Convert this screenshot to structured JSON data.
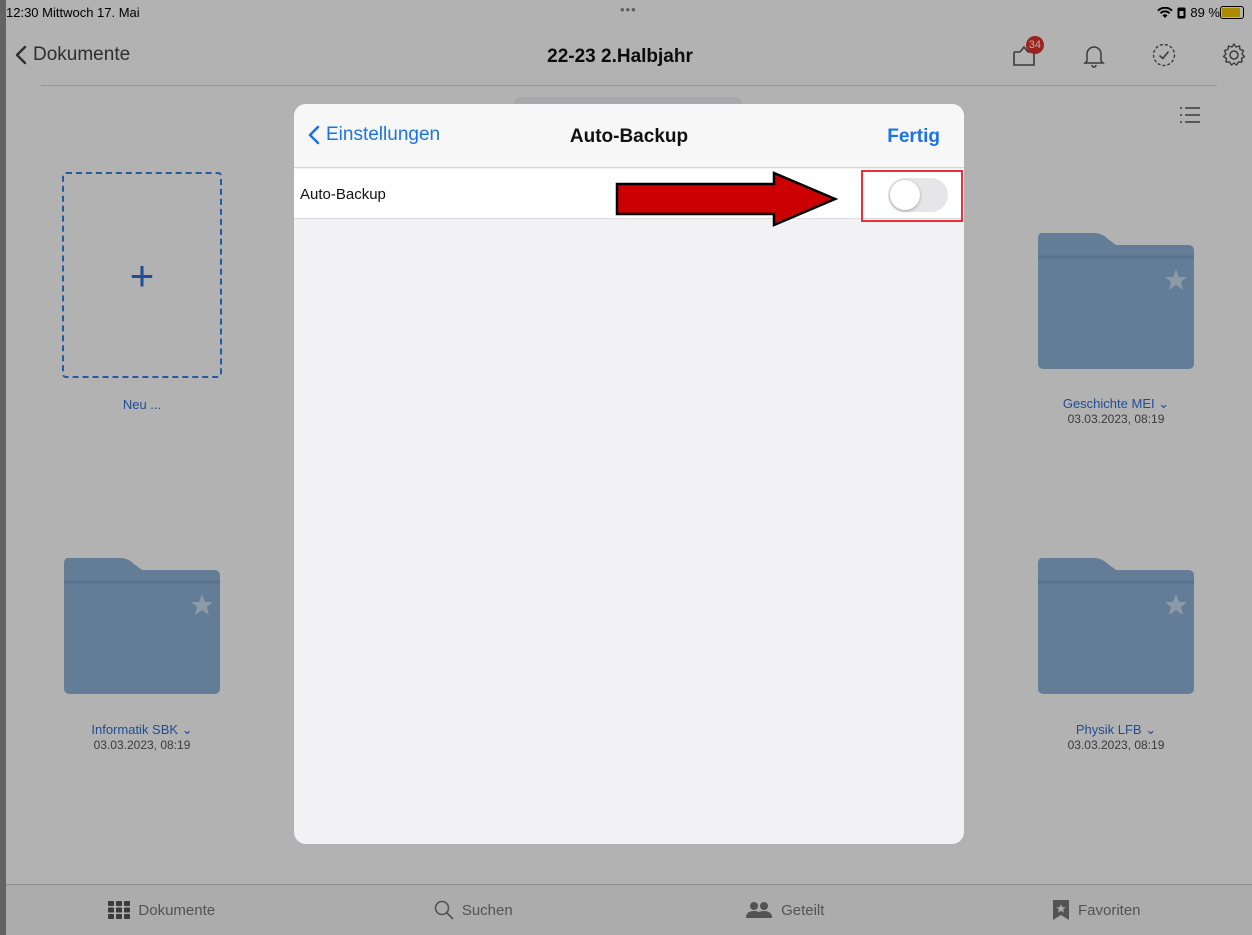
{
  "status": {
    "time_date": "12:30  Mittwoch 17. Mai",
    "dots": "•••",
    "battery": "89 %",
    "battery_level": 0.89
  },
  "nav": {
    "back_label": "Dokumente",
    "title": "22-23 2.Halbjahr",
    "badge_count": "34"
  },
  "tiles": {
    "new_label": "Neu ...",
    "folders": [
      {
        "name": "Geschichte MEI",
        "date": "03.03.2023, 08:19"
      },
      {
        "name": "Informatik SBK",
        "date": "03.03.2023, 08:19"
      },
      {
        "name": "Physik LFB",
        "date": "03.03.2023, 08:19"
      }
    ]
  },
  "tabs": [
    {
      "label": "Dokumente",
      "icon": "grid-icon"
    },
    {
      "label": "Suchen",
      "icon": "search-icon"
    },
    {
      "label": "Geteilt",
      "icon": "people-icon"
    },
    {
      "label": "Favoriten",
      "icon": "bookmark-star-icon"
    }
  ],
  "modal": {
    "back_label": "Einstellungen",
    "title": "Auto-Backup",
    "done_label": "Fertig",
    "row_label": "Auto-Backup",
    "toggle_on": false
  },
  "colors": {
    "accent": "#1a73e8",
    "highlight": "#e8303a",
    "arrow": "#cc0000",
    "folder": "#8fb3d9"
  }
}
